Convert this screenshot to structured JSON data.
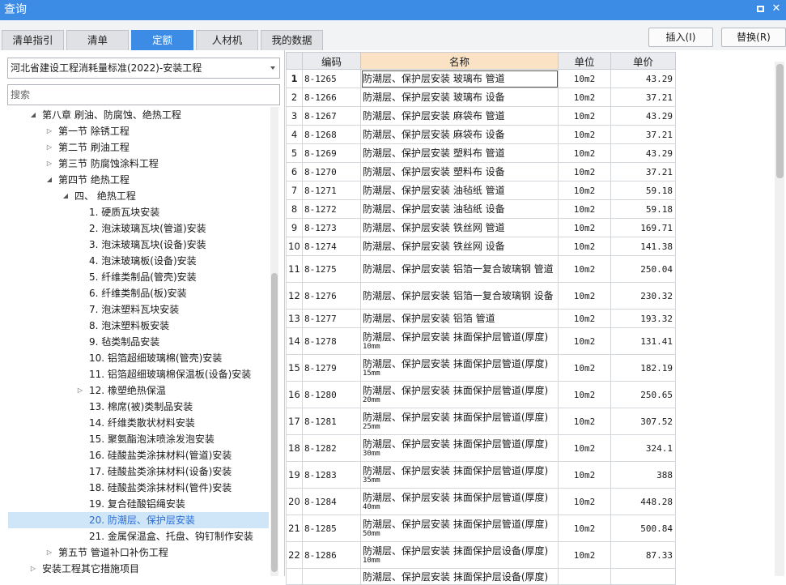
{
  "window": {
    "title": "查询",
    "close_glyph": "✕"
  },
  "tabs": [
    "清单指引",
    "清单",
    "定额",
    "人材机",
    "我的数据"
  ],
  "active_tab": 2,
  "buttons": {
    "insert": "插入(I)",
    "replace": "替换(R)"
  },
  "quota_select": {
    "value": "河北省建设工程消耗量标准(2022)-安装工程"
  },
  "search": {
    "placeholder": "搜索"
  },
  "tree": [
    {
      "label": "第八章  刷油、防腐蚀、绝热工程",
      "indent": 0,
      "arrow": "expanded",
      "sel": false
    },
    {
      "label": "第一节  除锈工程",
      "indent": 1,
      "arrow": "collapsed",
      "sel": false
    },
    {
      "label": "第二节  刷油工程",
      "indent": 1,
      "arrow": "collapsed",
      "sel": false
    },
    {
      "label": "第三节  防腐蚀涂料工程",
      "indent": 1,
      "arrow": "collapsed",
      "sel": false
    },
    {
      "label": "第四节  绝热工程",
      "indent": 1,
      "arrow": "expanded",
      "sel": false
    },
    {
      "label": "四、  绝热工程",
      "indent": 2,
      "arrow": "expanded",
      "sel": false
    },
    {
      "label": "1.  硬质瓦块安装",
      "indent": 3,
      "arrow": "",
      "sel": false
    },
    {
      "label": "2.  泡沫玻璃瓦块(管道)安装",
      "indent": 3,
      "arrow": "",
      "sel": false
    },
    {
      "label": "3.  泡沫玻璃瓦块(设备)安装",
      "indent": 3,
      "arrow": "",
      "sel": false
    },
    {
      "label": "4.  泡沫玻璃板(设备)安装",
      "indent": 3,
      "arrow": "",
      "sel": false
    },
    {
      "label": "5.  纤维类制品(管壳)安装",
      "indent": 3,
      "arrow": "",
      "sel": false
    },
    {
      "label": "6.  纤维类制品(板)安装",
      "indent": 3,
      "arrow": "",
      "sel": false
    },
    {
      "label": "7.  泡沫塑料瓦块安装",
      "indent": 3,
      "arrow": "",
      "sel": false
    },
    {
      "label": "8.  泡沫塑料板安装",
      "indent": 3,
      "arrow": "",
      "sel": false
    },
    {
      "label": "9.  毡类制品安装",
      "indent": 3,
      "arrow": "",
      "sel": false
    },
    {
      "label": "10.  铝箔超细玻璃棉(管壳)安装",
      "indent": 3,
      "arrow": "",
      "sel": false
    },
    {
      "label": "11.  铝箔超细玻璃棉保温板(设备)安装",
      "indent": 3,
      "arrow": "",
      "sel": false
    },
    {
      "label": "12.  橡塑绝热保温",
      "indent": 3,
      "arrow": "collapsed",
      "sel": false
    },
    {
      "label": "13.  棉席(被)类制品安装",
      "indent": 3,
      "arrow": "",
      "sel": false
    },
    {
      "label": "14.  纤维类散状材料安装",
      "indent": 3,
      "arrow": "",
      "sel": false
    },
    {
      "label": "15.  聚氨酯泡沫喷涂发泡安装",
      "indent": 3,
      "arrow": "",
      "sel": false
    },
    {
      "label": "16.  硅酸盐类涂抹材料(管道)安装",
      "indent": 3,
      "arrow": "",
      "sel": false
    },
    {
      "label": "17.  硅酸盐类涂抹材料(设备)安装",
      "indent": 3,
      "arrow": "",
      "sel": false
    },
    {
      "label": "18.  硅酸盐类涂抹材料(管件)安装",
      "indent": 3,
      "arrow": "",
      "sel": false
    },
    {
      "label": "19.  复合硅酸铝绳安装",
      "indent": 3,
      "arrow": "",
      "sel": false
    },
    {
      "label": "20.  防潮层、保护层安装",
      "indent": 3,
      "arrow": "",
      "sel": true
    },
    {
      "label": "21.  金属保温盒、托盘、钩钉制作安装",
      "indent": 3,
      "arrow": "",
      "sel": false
    },
    {
      "label": "第五节  管道补口补伤工程",
      "indent": 1,
      "arrow": "collapsed",
      "sel": false
    },
    {
      "label": "安装工程其它措施项目",
      "indent": 0,
      "arrow": "collapsed",
      "sel": false
    }
  ],
  "table": {
    "headers": {
      "code": "编码",
      "name": "名称",
      "unit": "单位",
      "price": "单价"
    },
    "rows": [
      {
        "n": "1",
        "code": "8-1265",
        "name": "防潮层、保护层安装 玻璃布 管道",
        "sub": "",
        "unit": "10m2",
        "price": "43.29"
      },
      {
        "n": "2",
        "code": "8-1266",
        "name": "防潮层、保护层安装 玻璃布 设备",
        "sub": "",
        "unit": "10m2",
        "price": "37.21"
      },
      {
        "n": "3",
        "code": "8-1267",
        "name": "防潮层、保护层安装 麻袋布 管道",
        "sub": "",
        "unit": "10m2",
        "price": "43.29"
      },
      {
        "n": "4",
        "code": "8-1268",
        "name": "防潮层、保护层安装 麻袋布 设备",
        "sub": "",
        "unit": "10m2",
        "price": "37.21"
      },
      {
        "n": "5",
        "code": "8-1269",
        "name": "防潮层、保护层安装 塑料布 管道",
        "sub": "",
        "unit": "10m2",
        "price": "43.29"
      },
      {
        "n": "6",
        "code": "8-1270",
        "name": "防潮层、保护层安装 塑料布 设备",
        "sub": "",
        "unit": "10m2",
        "price": "37.21"
      },
      {
        "n": "7",
        "code": "8-1271",
        "name": "防潮层、保护层安装 油毡纸 管道",
        "sub": "",
        "unit": "10m2",
        "price": "59.18"
      },
      {
        "n": "8",
        "code": "8-1272",
        "name": "防潮层、保护层安装 油毡纸 设备",
        "sub": "",
        "unit": "10m2",
        "price": "59.18"
      },
      {
        "n": "9",
        "code": "8-1273",
        "name": "防潮层、保护层安装 铁丝网 管道",
        "sub": "",
        "unit": "10m2",
        "price": "169.71"
      },
      {
        "n": "10",
        "code": "8-1274",
        "name": "防潮层、保护层安装 铁丝网 设备",
        "sub": "",
        "unit": "10m2",
        "price": "141.38"
      },
      {
        "n": "11",
        "code": "8-1275",
        "name": "防潮层、保护层安装 铝箔一复合玻璃钢 管道",
        "sub": "",
        "unit": "10m2",
        "price": "250.04"
      },
      {
        "n": "12",
        "code": "8-1276",
        "name": "防潮层、保护层安装 铝箔一复合玻璃钢 设备",
        "sub": "",
        "unit": "10m2",
        "price": "230.32"
      },
      {
        "n": "13",
        "code": "8-1277",
        "name": "防潮层、保护层安装 铝箔 管道",
        "sub": "",
        "unit": "10m2",
        "price": "193.32"
      },
      {
        "n": "14",
        "code": "8-1278",
        "name": "防潮层、保护层安装 抹面保护层管道(厚度)",
        "sub": "10mm",
        "unit": "10m2",
        "price": "131.41"
      },
      {
        "n": "15",
        "code": "8-1279",
        "name": "防潮层、保护层安装 抹面保护层管道(厚度)",
        "sub": "15mm",
        "unit": "10m2",
        "price": "182.19"
      },
      {
        "n": "16",
        "code": "8-1280",
        "name": "防潮层、保护层安装 抹面保护层管道(厚度)",
        "sub": "20mm",
        "unit": "10m2",
        "price": "250.65"
      },
      {
        "n": "17",
        "code": "8-1281",
        "name": "防潮层、保护层安装 抹面保护层管道(厚度)",
        "sub": "25mm",
        "unit": "10m2",
        "price": "307.52"
      },
      {
        "n": "18",
        "code": "8-1282",
        "name": "防潮层、保护层安装 抹面保护层管道(厚度)",
        "sub": "30mm",
        "unit": "10m2",
        "price": "324.1"
      },
      {
        "n": "19",
        "code": "8-1283",
        "name": "防潮层、保护层安装 抹面保护层管道(厚度)",
        "sub": "35mm",
        "unit": "10m2",
        "price": "388"
      },
      {
        "n": "20",
        "code": "8-1284",
        "name": "防潮层、保护层安装 抹面保护层管道(厚度)",
        "sub": "40mm",
        "unit": "10m2",
        "price": "448.28"
      },
      {
        "n": "21",
        "code": "8-1285",
        "name": "防潮层、保护层安装 抹面保护层管道(厚度)",
        "sub": "50mm",
        "unit": "10m2",
        "price": "500.84"
      },
      {
        "n": "22",
        "code": "8-1286",
        "name": "防潮层、保护层安装 抹面保护层设备(厚度)",
        "sub": "10mm",
        "unit": "10m2",
        "price": "87.33"
      },
      {
        "n": "",
        "code": "",
        "name": "防潮层、保护层安装 抹面保护层设备(厚度)",
        "sub": "",
        "unit": "",
        "price": ""
      }
    ]
  }
}
